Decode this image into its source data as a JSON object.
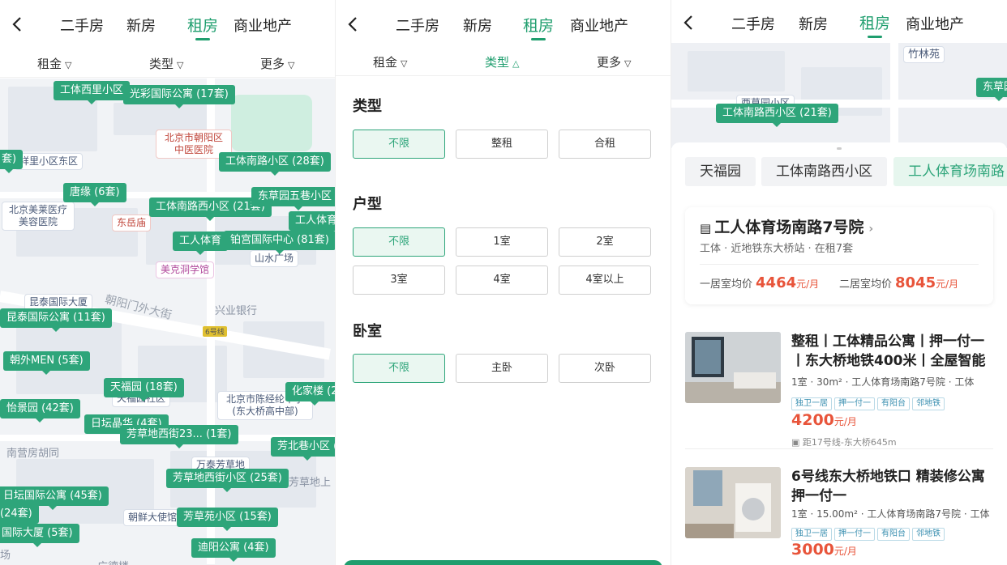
{
  "nav": {
    "tabs": [
      "二手房",
      "新房",
      "租房",
      "商业地产"
    ],
    "active_tab": "租房"
  },
  "filters": {
    "rent": "租金",
    "type": "类型",
    "more": "更多"
  },
  "map1": {
    "pins": [
      "工体西里小区",
      "光彩国际公寓 (17套)",
      "工体南路小区 (28套)",
      "唐缘 (6套)",
      "工体南路西小区 (21套)",
      "东草园五巷小区 (",
      "工人体育",
      "工人体育",
      "铂宫国际中心 (81套)",
      "昆泰国际公寓 (11套)",
      "朝外MEN (5套)",
      "天福园 (18套)",
      "怡景园 (42套)",
      "日坛晶华 (4套)",
      "芳草地西街23... (1套)",
      "化家楼 (2",
      "芳北巷小区 (",
      "芳草地西街小区 (25套)",
      "日坛国际公寓 (45套)",
      "(24套)",
      "芳草苑小区 (15套)",
      "国际大厦 (5套)",
      "迪阳公寓 (4套)",
      "套)"
    ],
    "pois": [
      "北京市朝阳区中医医院",
      "祥里小区东区",
      "北京美莱医疗美容医院",
      "东岳庙",
      "山水广场",
      "美克洞学馆",
      "昆泰国际大厦",
      "北京市陈经纶中学(东大桥高中部)",
      "天福园社区",
      "万泰芳草地",
      "朝鲜大使馆"
    ],
    "labels": [
      "朝阳门外大街",
      "兴业银行",
      "南营房胡同",
      "芳草地上",
      "6号线",
      "场",
      "广德楼"
    ]
  },
  "panel": {
    "type": {
      "title": "类型",
      "options": [
        "不限",
        "整租",
        "合租"
      ],
      "selected": "不限"
    },
    "layout": {
      "title": "户型",
      "options": [
        "不限",
        "1室",
        "2室",
        "3室",
        "4室",
        "4室以上"
      ],
      "selected": "不限"
    },
    "bedroom": {
      "title": "卧室",
      "options": [
        "不限",
        "主卧",
        "次卧"
      ],
      "selected": "不限"
    }
  },
  "map3": {
    "labels": [
      "竹林苑",
      "东草园",
      "工体南路西小区 (21套)",
      "西草园小区"
    ]
  },
  "estates_tabs": [
    "天福园",
    "工体南路西小区",
    "工人体育场南路"
  ],
  "estate": {
    "name": "工人体育场南路7号院",
    "sub": "工体 · 近地铁东大桥站 · 在租7套",
    "one_label": "一居室均价",
    "one_price": "4464",
    "two_label": "二居室均价",
    "two_price": "8045",
    "unit": "元/月"
  },
  "listings": [
    {
      "title": "整租丨工体精品公寓丨押一付一丨东大桥地铁400米丨全屋智能",
      "meta": "1室 · 30m² · 工人体育场南路7号院 · 工体",
      "tags": [
        "独卫一居",
        "押一付一",
        "有阳台",
        "邻地铁"
      ],
      "price": "4200",
      "unit": "元/月",
      "distance": "距17号线-东大桥645m"
    },
    {
      "title": "6号线东大桥地铁口 精装修公寓 押一付一",
      "meta": "1室 · 15.00m² · 工人体育场南路7号院 · 工体",
      "tags": [
        "独卫一居",
        "押一付一",
        "有阳台",
        "邻地铁"
      ],
      "price": "3000",
      "unit": "元/月",
      "distance": ""
    }
  ],
  "colors": {
    "accent": "#1f9e6e",
    "pin": "#2ea57a",
    "price": "#e8543a"
  }
}
